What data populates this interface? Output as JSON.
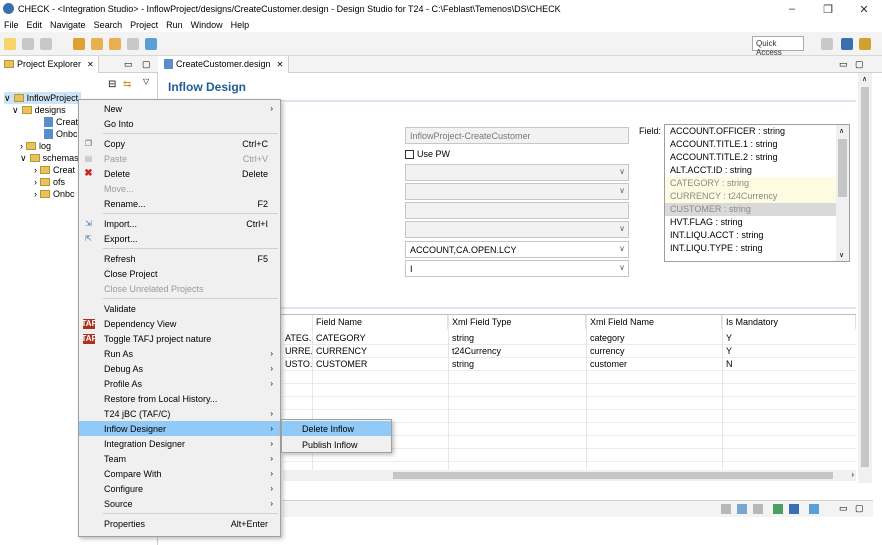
{
  "window": {
    "title": "CHECK - <Integration Studio> - InflowProject/designs/CreateCustomer.design - Design Studio for T24 - C:\\Feblast\\Temenos\\DS\\CHECK",
    "controls": [
      "–",
      "❐",
      "✕"
    ]
  },
  "menubar": [
    "File",
    "Edit",
    "Navigate",
    "Search",
    "Project",
    "Run",
    "Window",
    "Help"
  ],
  "toolbar": {
    "quick_access": "Quick Access"
  },
  "project_explorer": {
    "tab_label": "Project Explorer",
    "tree": [
      {
        "label": "InflowProject",
        "type": "project"
      },
      {
        "label": "designs",
        "type": "folder"
      },
      {
        "label": "Creat",
        "type": "file"
      },
      {
        "label": "Onbc",
        "type": "file"
      },
      {
        "label": "log",
        "type": "folder"
      },
      {
        "label": "schemas",
        "type": "folder"
      },
      {
        "label": "Creat",
        "type": "folder"
      },
      {
        "label": "ofs",
        "type": "folder"
      },
      {
        "label": "Onbc",
        "type": "folder"
      }
    ]
  },
  "editor": {
    "tab_label": "CreateCustomer.design",
    "heading": "Inflow Design",
    "name_value": "InflowProject-CreateCustomer",
    "use_pw_label": "Use PW",
    "application_value": "ACCOUNT,CA.OPEN.LCY",
    "function_value": "I",
    "field_label": "Field:",
    "field_list": [
      {
        "text": "ACCOUNT.OFFICER : string",
        "state": "normal"
      },
      {
        "text": "ACCOUNT.TITLE.1 : string",
        "state": "normal"
      },
      {
        "text": "ACCOUNT.TITLE.2 : string",
        "state": "normal"
      },
      {
        "text": "ALT.ACCT.ID : string",
        "state": "normal"
      },
      {
        "text": "CATEGORY : string",
        "state": "used"
      },
      {
        "text": "CURRENCY : t24Currency",
        "state": "used"
      },
      {
        "text": "CUSTOMER : string",
        "state": "selected"
      },
      {
        "text": "HVT.FLAG : string",
        "state": "normal"
      },
      {
        "text": "INT.LIQU.ACCT : string",
        "state": "normal"
      },
      {
        "text": "INT.LIQU.TYPE : string",
        "state": "normal"
      }
    ],
    "table": {
      "headers": [
        "Field Name",
        "Xml Field Type",
        "Xml Field Name",
        "Is Mandatory"
      ],
      "rows": [
        {
          "trunc": "ATEG...",
          "field": "CATEGORY",
          "type": "string",
          "xml": "category",
          "mand": "Y"
        },
        {
          "trunc": "URRE...",
          "field": "CURRENCY",
          "type": "t24Currency",
          "xml": "currency",
          "mand": "Y"
        },
        {
          "trunc": "USTO...",
          "field": "CUSTOMER",
          "type": "string",
          "xml": "customer",
          "mand": "N"
        }
      ]
    }
  },
  "context_menu": {
    "items": [
      {
        "label": "New",
        "shortcut": "",
        "submenu": true
      },
      {
        "label": "Go Into",
        "shortcut": ""
      },
      {
        "label": "Copy",
        "shortcut": "Ctrl+C"
      },
      {
        "label": "Paste",
        "shortcut": "Ctrl+V",
        "disabled": true
      },
      {
        "label": "Delete",
        "shortcut": "Delete"
      },
      {
        "label": "Move...",
        "shortcut": "",
        "disabled": true
      },
      {
        "label": "Rename...",
        "shortcut": "F2"
      },
      {
        "label": "Import...",
        "shortcut": "Ctrl+I"
      },
      {
        "label": "Export...",
        "shortcut": ""
      },
      {
        "label": "Refresh",
        "shortcut": "F5"
      },
      {
        "label": "Close Project",
        "shortcut": ""
      },
      {
        "label": "Close Unrelated Projects",
        "shortcut": "",
        "disabled": true
      },
      {
        "label": "Validate",
        "shortcut": ""
      },
      {
        "label": "Dependency View",
        "shortcut": ""
      },
      {
        "label": "Toggle TAFJ project nature",
        "shortcut": ""
      },
      {
        "label": "Run As",
        "shortcut": "",
        "submenu": true
      },
      {
        "label": "Debug As",
        "shortcut": "",
        "submenu": true
      },
      {
        "label": "Profile As",
        "shortcut": "",
        "submenu": true
      },
      {
        "label": "Restore from Local History...",
        "shortcut": ""
      },
      {
        "label": "T24 jBC (TAF/C)",
        "shortcut": "",
        "submenu": true
      },
      {
        "label": "Inflow Designer",
        "shortcut": "",
        "submenu": true,
        "highlighted": true
      },
      {
        "label": "Integration Designer",
        "shortcut": "",
        "submenu": true
      },
      {
        "label": "Team",
        "shortcut": "",
        "submenu": true
      },
      {
        "label": "Compare With",
        "shortcut": "",
        "submenu": true
      },
      {
        "label": "Configure",
        "shortcut": "",
        "submenu": true
      },
      {
        "label": "Source",
        "shortcut": "",
        "submenu": true
      },
      {
        "label": "Properties",
        "shortcut": "Alt+Enter"
      }
    ],
    "taf_badge": "TAF"
  },
  "submenu": {
    "items": [
      {
        "label": "Delete Inflow",
        "highlighted": true
      },
      {
        "label": "Publish Inflow"
      }
    ]
  },
  "colors": {
    "accent": "#1f5d99",
    "highlight": "#91c9f7"
  }
}
